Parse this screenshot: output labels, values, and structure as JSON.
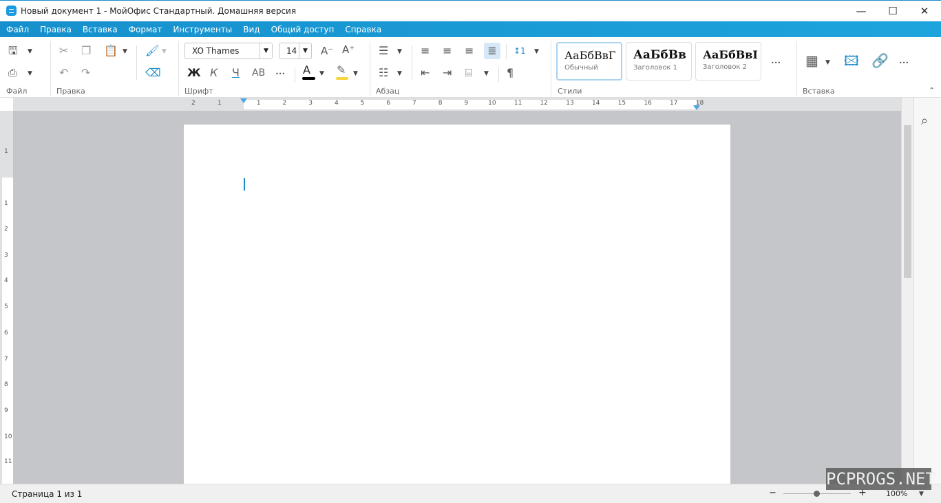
{
  "window": {
    "title": "Новый документ 1 - МойОфис Стандартный. Домашняя версия",
    "controls": {
      "minimize": "—",
      "maximize": "☐",
      "close": "✕"
    }
  },
  "menu": [
    "Файл",
    "Правка",
    "Вставка",
    "Формат",
    "Инструменты",
    "Вид",
    "Общий доступ",
    "Справка"
  ],
  "ribbon": {
    "groups": {
      "file": "Файл",
      "edit": "Правка",
      "font": "Шрифт",
      "paragraph": "Абзац",
      "styles": "Стили",
      "insert": "Вставка"
    },
    "font_name": "XO Thames",
    "font_size": "14",
    "font_buttons": {
      "bold": "Ж",
      "italic": "К",
      "underline": "Ч",
      "caps": "АВ",
      "more": "•••"
    },
    "styles": [
      {
        "preview": "АаБбВвГ",
        "name": "Обычный"
      },
      {
        "preview": "АаБбВв",
        "name": "Заголовок 1"
      },
      {
        "preview": "АаБбВвI",
        "name": "Заголовок 2"
      }
    ],
    "more": "•••",
    "font_color": "#000000",
    "highlight_color": "#f5d63d",
    "accent": "#1a9ad6"
  },
  "ruler": {
    "h": [
      "2",
      "1",
      "1",
      "2",
      "3",
      "4",
      "5",
      "6",
      "7",
      "8",
      "9",
      "10",
      "11",
      "12",
      "13",
      "14",
      "15",
      "16",
      "17",
      "18"
    ],
    "v": [
      "1",
      "1",
      "2",
      "3",
      "4",
      "5",
      "6",
      "7",
      "8",
      "9",
      "10",
      "11"
    ]
  },
  "status": {
    "page": "Страница 1 из 1",
    "zoom": "100%",
    "zoom_minus": "−",
    "zoom_plus": "+",
    "zoom_level": 100
  },
  "watermark": "PCPROGS.NET"
}
